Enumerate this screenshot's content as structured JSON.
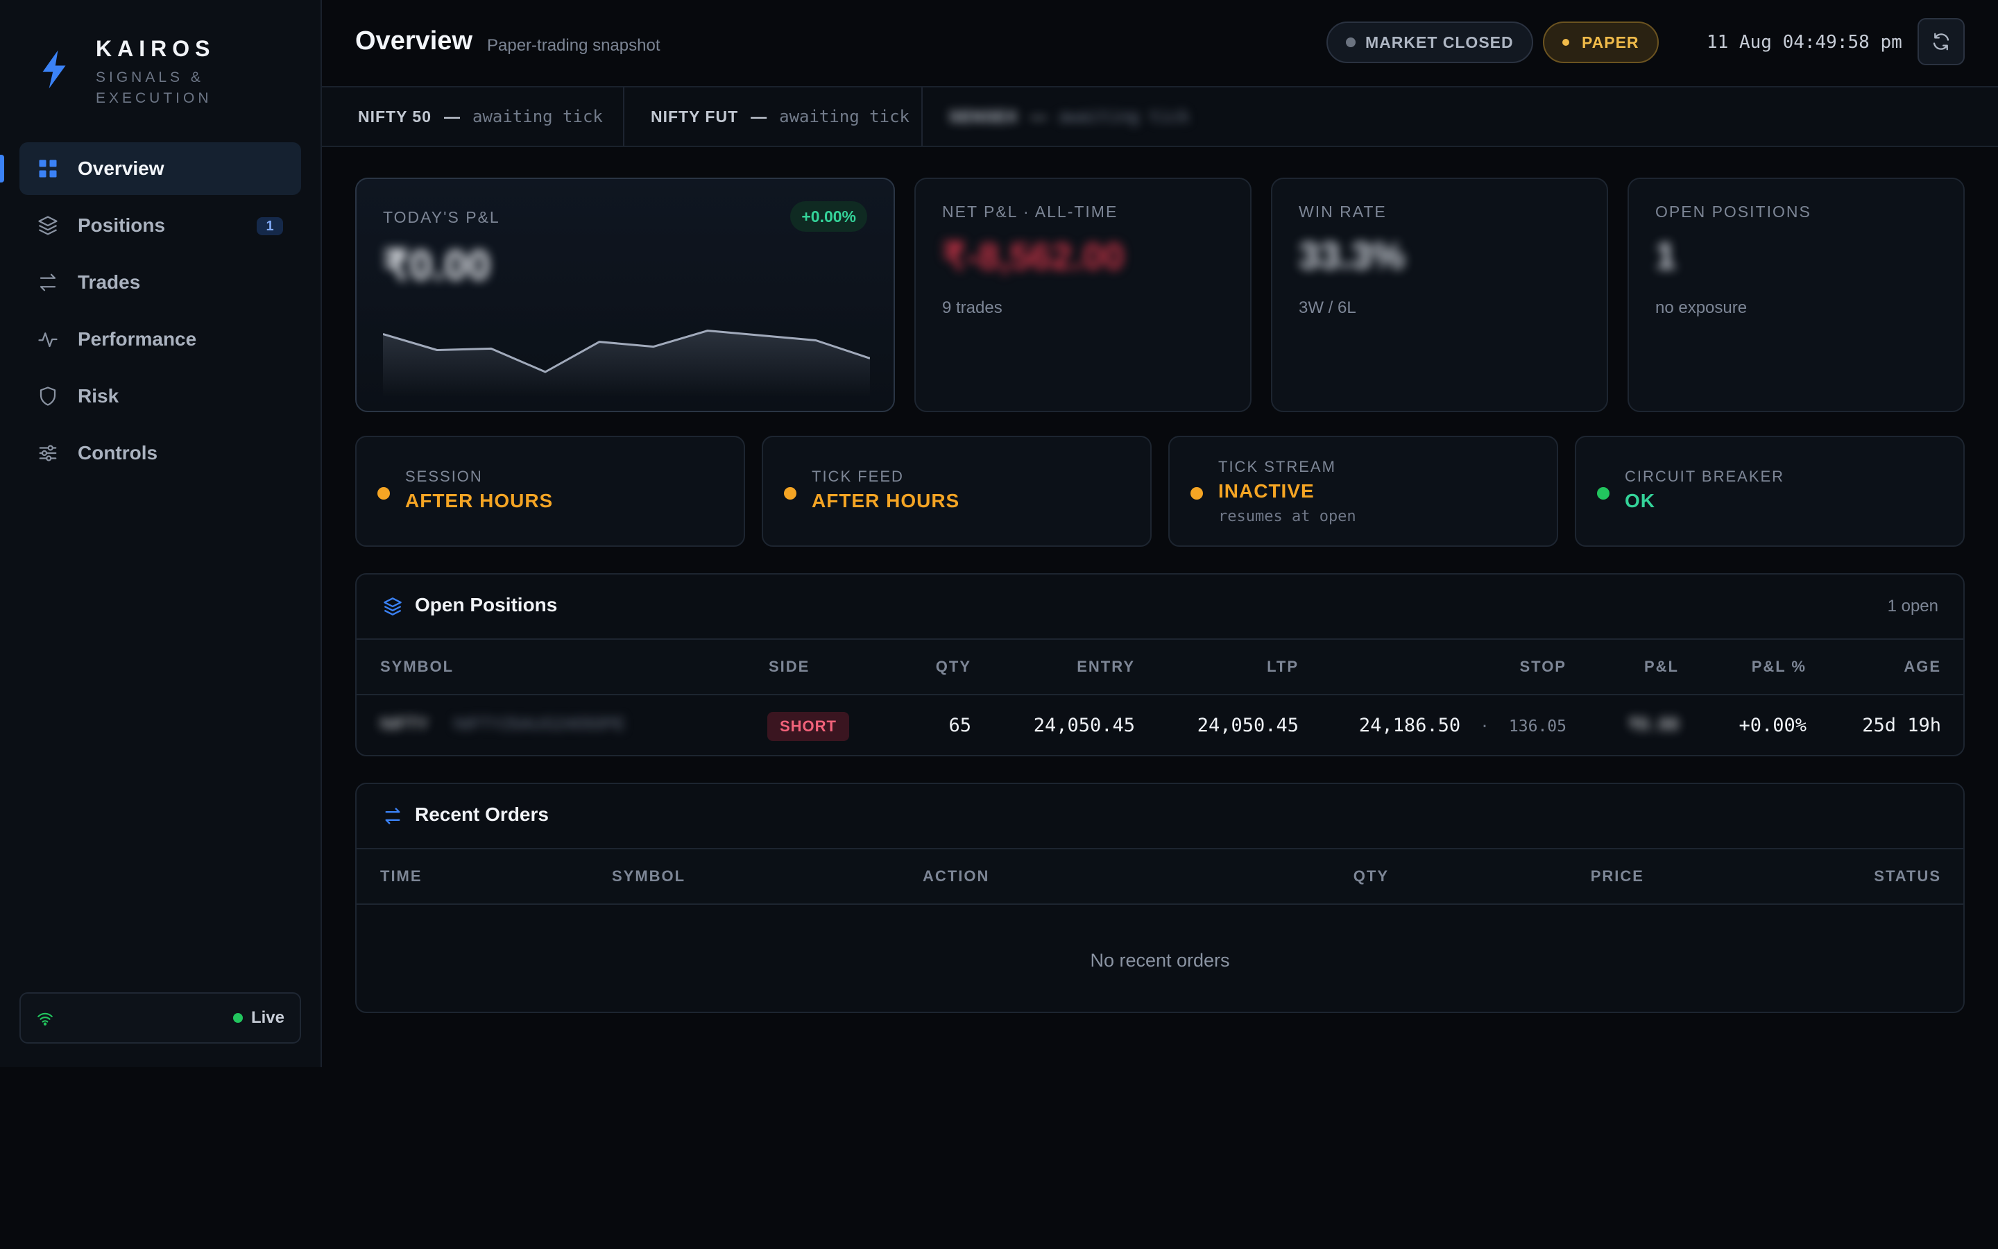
{
  "brand": {
    "name": "KAIROS",
    "tagline": "SIGNALS & EXECUTION"
  },
  "nav": [
    {
      "label": "Overview",
      "icon": "grid-icon",
      "active": true
    },
    {
      "label": "Positions",
      "icon": "layers-icon",
      "badge": "1"
    },
    {
      "label": "Trades",
      "icon": "swap-arrows-icon"
    },
    {
      "label": "Performance",
      "icon": "pulse-icon"
    },
    {
      "label": "Risk",
      "icon": "shield-icon"
    },
    {
      "label": "Controls",
      "icon": "sliders-icon"
    }
  ],
  "connection": {
    "status": "Live",
    "icon": "wifi-icon"
  },
  "header": {
    "title": "Overview",
    "subtitle": "Paper-trading snapshot",
    "market_status": "MARKET CLOSED",
    "mode": "PAPER",
    "timestamp": "11 Aug 04:49:58 pm"
  },
  "ticker": [
    {
      "symbol": "NIFTY 50",
      "value": "awaiting tick"
    },
    {
      "symbol": "NIFTY FUT",
      "value": "awaiting tick"
    },
    {
      "symbol": "SENSEX",
      "value": "awaiting tick"
    }
  ],
  "stats": {
    "today_pl": {
      "label": "TODAY'S P&L",
      "value": "₹0.00",
      "change": "+0.00%"
    },
    "net_pl": {
      "label": "NET P&L · ALL-TIME",
      "value": "₹-8,562.00",
      "meta": "9 trades"
    },
    "win_rate": {
      "label": "WIN RATE",
      "value": "33.3%",
      "meta": "3W / 6L"
    },
    "open_positions": {
      "label": "OPEN POSITIONS",
      "value": "1",
      "meta": "no exposure"
    }
  },
  "sparkline": [
    0.78,
    0.45,
    0.48,
    0.0,
    0.62,
    0.52,
    0.85,
    0.75,
    0.65,
    0.28
  ],
  "status_cards": [
    {
      "label": "SESSION",
      "value": "AFTER HOURS",
      "color": "#f5a524"
    },
    {
      "label": "TICK FEED",
      "value": "AFTER HOURS",
      "color": "#f5a524"
    },
    {
      "label": "TICK STREAM",
      "value": "INACTIVE",
      "note": "resumes at open",
      "color": "#f5a524"
    },
    {
      "label": "CIRCUIT BREAKER",
      "value": "OK",
      "color": "#22c55e"
    }
  ],
  "open_positions": {
    "title": "Open Positions",
    "count": "1 open",
    "columns": [
      "SYMBOL",
      "SIDE",
      "QTY",
      "ENTRY",
      "LTP",
      "STOP",
      "P&L",
      "P&L %",
      "AGE"
    ],
    "rows": [
      {
        "symbol": "NIFTY",
        "symbol_detail": "NIFTY25AUG24050PE",
        "side": "SHORT",
        "qty": "65",
        "entry": "24,050.45",
        "ltp": "24,050.45",
        "stop": "24,186.50",
        "stop_dist": "136.05",
        "pl": "₹0.00",
        "pl_pct": "+0.00%",
        "age": "25d 19h"
      }
    ]
  },
  "recent_orders": {
    "title": "Recent Orders",
    "columns": [
      "TIME",
      "SYMBOL",
      "ACTION",
      "QTY",
      "PRICE",
      "STATUS"
    ],
    "empty": "No recent orders"
  },
  "colors": {
    "accent": "#3b82f6",
    "positive": "#34d399",
    "negative": "#f2627a",
    "warning": "#f5a524",
    "paper": "#f0bb4a"
  }
}
